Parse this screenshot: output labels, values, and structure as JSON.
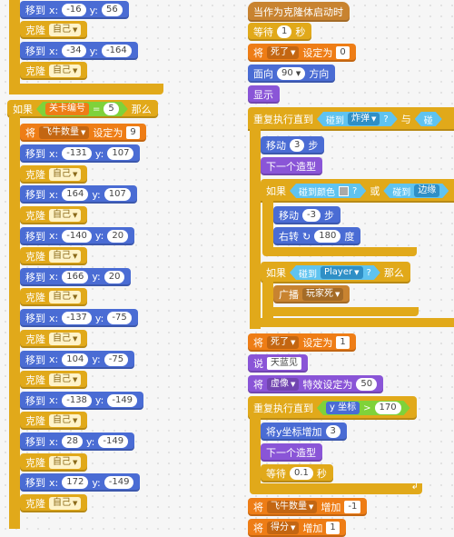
{
  "left_script": {
    "top_blocks": [
      {
        "kind": "motion",
        "label": "移到",
        "x_label": "x:",
        "x": "-16",
        "y_label": "y:",
        "y": "56"
      },
      {
        "kind": "control",
        "label": "克隆",
        "target": "自己"
      },
      {
        "kind": "motion",
        "label": "移到",
        "x_label": "x:",
        "x": "-34",
        "y_label": "y:",
        "y": "-164"
      },
      {
        "kind": "control",
        "label": "克隆",
        "target": "自己"
      }
    ],
    "if_block": {
      "label": "如果",
      "var": "关卡编号",
      "op": "=",
      "value": "5",
      "then": "那么",
      "set_label": "将",
      "set_var": "飞牛数量",
      "set_to": "设定为",
      "set_value": "9"
    },
    "pairs": [
      {
        "move": "移到",
        "x": "-131",
        "y": "107",
        "clone": "克隆",
        "target": "自己"
      },
      {
        "move": "移到",
        "x": "164",
        "y": "107",
        "clone": "克隆",
        "target": "自己"
      },
      {
        "move": "移到",
        "x": "-140",
        "y": "20",
        "clone": "克隆",
        "target": "自己"
      },
      {
        "move": "移到",
        "x": "166",
        "y": "20",
        "clone": "克隆",
        "target": "自己"
      },
      {
        "move": "移到",
        "x": "-137",
        "y": "-75",
        "clone": "克隆",
        "target": "自己"
      },
      {
        "move": "移到",
        "x": "104",
        "y": "-75",
        "clone": "克隆",
        "target": "自己"
      },
      {
        "move": "移到",
        "x": "-138",
        "y": "-149",
        "clone": "克隆",
        "target": "自己"
      },
      {
        "move": "移到",
        "x": "28",
        "y": "-149",
        "clone": "克隆",
        "target": "自己"
      },
      {
        "move": "移到",
        "x": "172",
        "y": "-149",
        "clone": "克隆",
        "target": "自己"
      }
    ],
    "x_label": "x:",
    "y_label": "y:"
  },
  "right_script": {
    "hat": "当作为克隆体启动时",
    "wait": {
      "label": "等待",
      "value": "1",
      "unit": "秒"
    },
    "set_dead": {
      "label": "将",
      "var": "死了",
      "to": "设定为",
      "value": "0"
    },
    "point": {
      "label": "面向",
      "value": "90",
      "unit": "方向"
    },
    "show": "显示",
    "repeat1": {
      "label": "重复执行直到",
      "touch": "碰到",
      "target": "炸弹",
      "q": "?",
      "and": "与",
      "touch2": "碰"
    },
    "move3": {
      "label": "移动",
      "value": "3",
      "unit": "步"
    },
    "next_costume": "下一个造型",
    "if_color": {
      "label": "如果",
      "touch_color": "碰到颜色",
      "q": "?",
      "or": "或",
      "touch": "碰到",
      "target": "边缘"
    },
    "move_neg3": {
      "label": "移动",
      "value": "-3",
      "unit": "步"
    },
    "turn": {
      "label": "右转",
      "value": "180",
      "unit": "度"
    },
    "if_player": {
      "label": "如果",
      "touch": "碰到",
      "target": "Player",
      "q": "?",
      "then": "那么"
    },
    "broadcast": {
      "label": "广播",
      "message": "玩家死"
    },
    "set_dead1": {
      "label": "将",
      "var": "死了",
      "to": "设定为",
      "value": "1"
    },
    "say": {
      "label": "说",
      "text": "天蓝见"
    },
    "effect": {
      "label": "将",
      "effect": "虚像",
      "to": "特效设定为",
      "value": "50"
    },
    "repeat2": {
      "label": "重复执行直到",
      "var": "y 坐标",
      "op": ">",
      "value": "170"
    },
    "change_y": {
      "label": "将y坐标增加",
      "value": "3"
    },
    "next_costume2": "下一个造型",
    "wait2": {
      "label": "等待",
      "value": "0.1",
      "unit": "秒"
    },
    "change_cows": {
      "label": "将",
      "var": "飞牛数量",
      "by": "增加",
      "value": "-1"
    },
    "change_score": {
      "label": "将",
      "var": "得分",
      "by": "增加",
      "value": "1"
    }
  },
  "colors": {
    "motion": "#4a6cd4",
    "control": "#e1a91a",
    "data": "#ee7d16",
    "looks": "#8a55d7",
    "sensing": "#2ca5e2",
    "operator": "#5cb712",
    "events": "#c88330"
  }
}
